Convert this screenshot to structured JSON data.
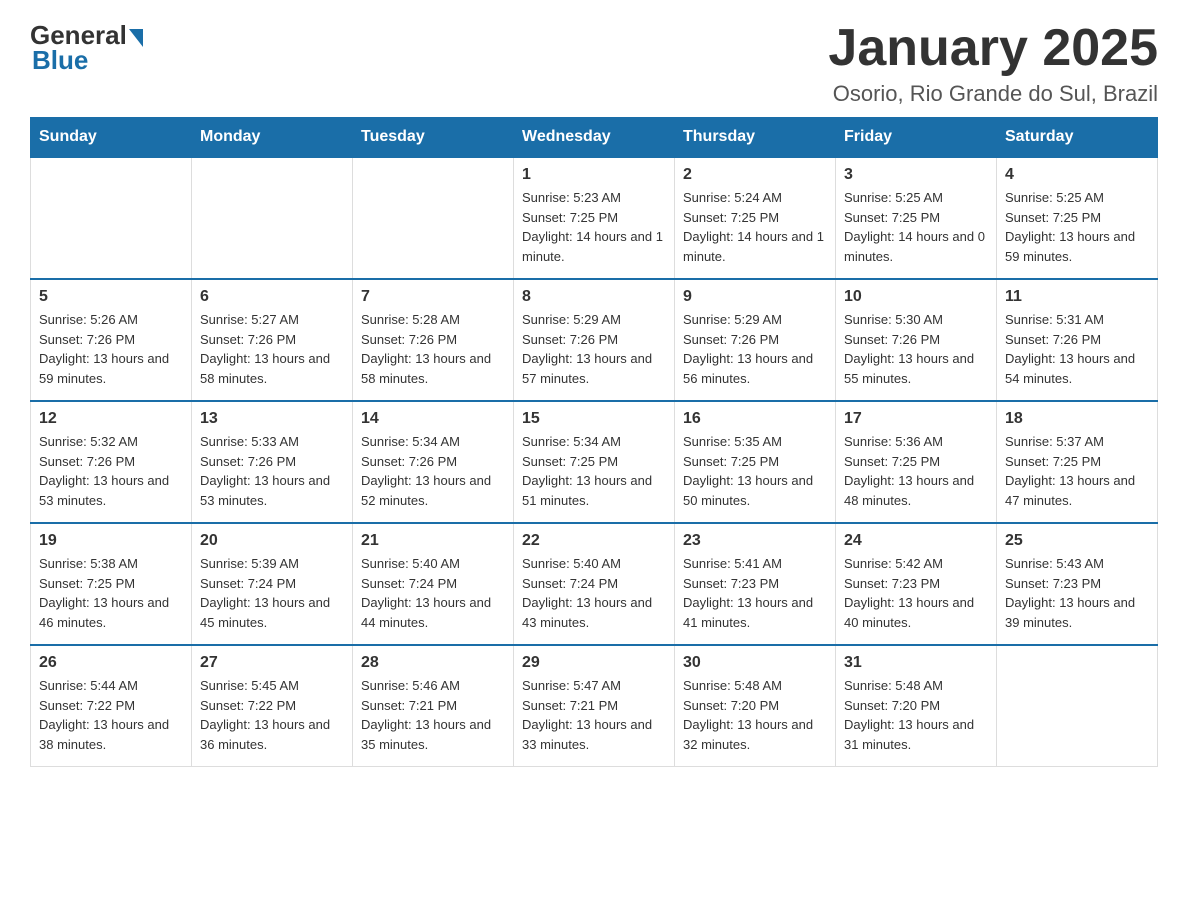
{
  "logo": {
    "general": "General",
    "blue": "Blue"
  },
  "title": "January 2025",
  "subtitle": "Osorio, Rio Grande do Sul, Brazil",
  "days_of_week": [
    "Sunday",
    "Monday",
    "Tuesday",
    "Wednesday",
    "Thursday",
    "Friday",
    "Saturday"
  ],
  "weeks": [
    [
      {
        "day": "",
        "info": ""
      },
      {
        "day": "",
        "info": ""
      },
      {
        "day": "",
        "info": ""
      },
      {
        "day": "1",
        "info": "Sunrise: 5:23 AM\nSunset: 7:25 PM\nDaylight: 14 hours and 1 minute."
      },
      {
        "day": "2",
        "info": "Sunrise: 5:24 AM\nSunset: 7:25 PM\nDaylight: 14 hours and 1 minute."
      },
      {
        "day": "3",
        "info": "Sunrise: 5:25 AM\nSunset: 7:25 PM\nDaylight: 14 hours and 0 minutes."
      },
      {
        "day": "4",
        "info": "Sunrise: 5:25 AM\nSunset: 7:25 PM\nDaylight: 13 hours and 59 minutes."
      }
    ],
    [
      {
        "day": "5",
        "info": "Sunrise: 5:26 AM\nSunset: 7:26 PM\nDaylight: 13 hours and 59 minutes."
      },
      {
        "day": "6",
        "info": "Sunrise: 5:27 AM\nSunset: 7:26 PM\nDaylight: 13 hours and 58 minutes."
      },
      {
        "day": "7",
        "info": "Sunrise: 5:28 AM\nSunset: 7:26 PM\nDaylight: 13 hours and 58 minutes."
      },
      {
        "day": "8",
        "info": "Sunrise: 5:29 AM\nSunset: 7:26 PM\nDaylight: 13 hours and 57 minutes."
      },
      {
        "day": "9",
        "info": "Sunrise: 5:29 AM\nSunset: 7:26 PM\nDaylight: 13 hours and 56 minutes."
      },
      {
        "day": "10",
        "info": "Sunrise: 5:30 AM\nSunset: 7:26 PM\nDaylight: 13 hours and 55 minutes."
      },
      {
        "day": "11",
        "info": "Sunrise: 5:31 AM\nSunset: 7:26 PM\nDaylight: 13 hours and 54 minutes."
      }
    ],
    [
      {
        "day": "12",
        "info": "Sunrise: 5:32 AM\nSunset: 7:26 PM\nDaylight: 13 hours and 53 minutes."
      },
      {
        "day": "13",
        "info": "Sunrise: 5:33 AM\nSunset: 7:26 PM\nDaylight: 13 hours and 53 minutes."
      },
      {
        "day": "14",
        "info": "Sunrise: 5:34 AM\nSunset: 7:26 PM\nDaylight: 13 hours and 52 minutes."
      },
      {
        "day": "15",
        "info": "Sunrise: 5:34 AM\nSunset: 7:25 PM\nDaylight: 13 hours and 51 minutes."
      },
      {
        "day": "16",
        "info": "Sunrise: 5:35 AM\nSunset: 7:25 PM\nDaylight: 13 hours and 50 minutes."
      },
      {
        "day": "17",
        "info": "Sunrise: 5:36 AM\nSunset: 7:25 PM\nDaylight: 13 hours and 48 minutes."
      },
      {
        "day": "18",
        "info": "Sunrise: 5:37 AM\nSunset: 7:25 PM\nDaylight: 13 hours and 47 minutes."
      }
    ],
    [
      {
        "day": "19",
        "info": "Sunrise: 5:38 AM\nSunset: 7:25 PM\nDaylight: 13 hours and 46 minutes."
      },
      {
        "day": "20",
        "info": "Sunrise: 5:39 AM\nSunset: 7:24 PM\nDaylight: 13 hours and 45 minutes."
      },
      {
        "day": "21",
        "info": "Sunrise: 5:40 AM\nSunset: 7:24 PM\nDaylight: 13 hours and 44 minutes."
      },
      {
        "day": "22",
        "info": "Sunrise: 5:40 AM\nSunset: 7:24 PM\nDaylight: 13 hours and 43 minutes."
      },
      {
        "day": "23",
        "info": "Sunrise: 5:41 AM\nSunset: 7:23 PM\nDaylight: 13 hours and 41 minutes."
      },
      {
        "day": "24",
        "info": "Sunrise: 5:42 AM\nSunset: 7:23 PM\nDaylight: 13 hours and 40 minutes."
      },
      {
        "day": "25",
        "info": "Sunrise: 5:43 AM\nSunset: 7:23 PM\nDaylight: 13 hours and 39 minutes."
      }
    ],
    [
      {
        "day": "26",
        "info": "Sunrise: 5:44 AM\nSunset: 7:22 PM\nDaylight: 13 hours and 38 minutes."
      },
      {
        "day": "27",
        "info": "Sunrise: 5:45 AM\nSunset: 7:22 PM\nDaylight: 13 hours and 36 minutes."
      },
      {
        "day": "28",
        "info": "Sunrise: 5:46 AM\nSunset: 7:21 PM\nDaylight: 13 hours and 35 minutes."
      },
      {
        "day": "29",
        "info": "Sunrise: 5:47 AM\nSunset: 7:21 PM\nDaylight: 13 hours and 33 minutes."
      },
      {
        "day": "30",
        "info": "Sunrise: 5:48 AM\nSunset: 7:20 PM\nDaylight: 13 hours and 32 minutes."
      },
      {
        "day": "31",
        "info": "Sunrise: 5:48 AM\nSunset: 7:20 PM\nDaylight: 13 hours and 31 minutes."
      },
      {
        "day": "",
        "info": ""
      }
    ]
  ]
}
